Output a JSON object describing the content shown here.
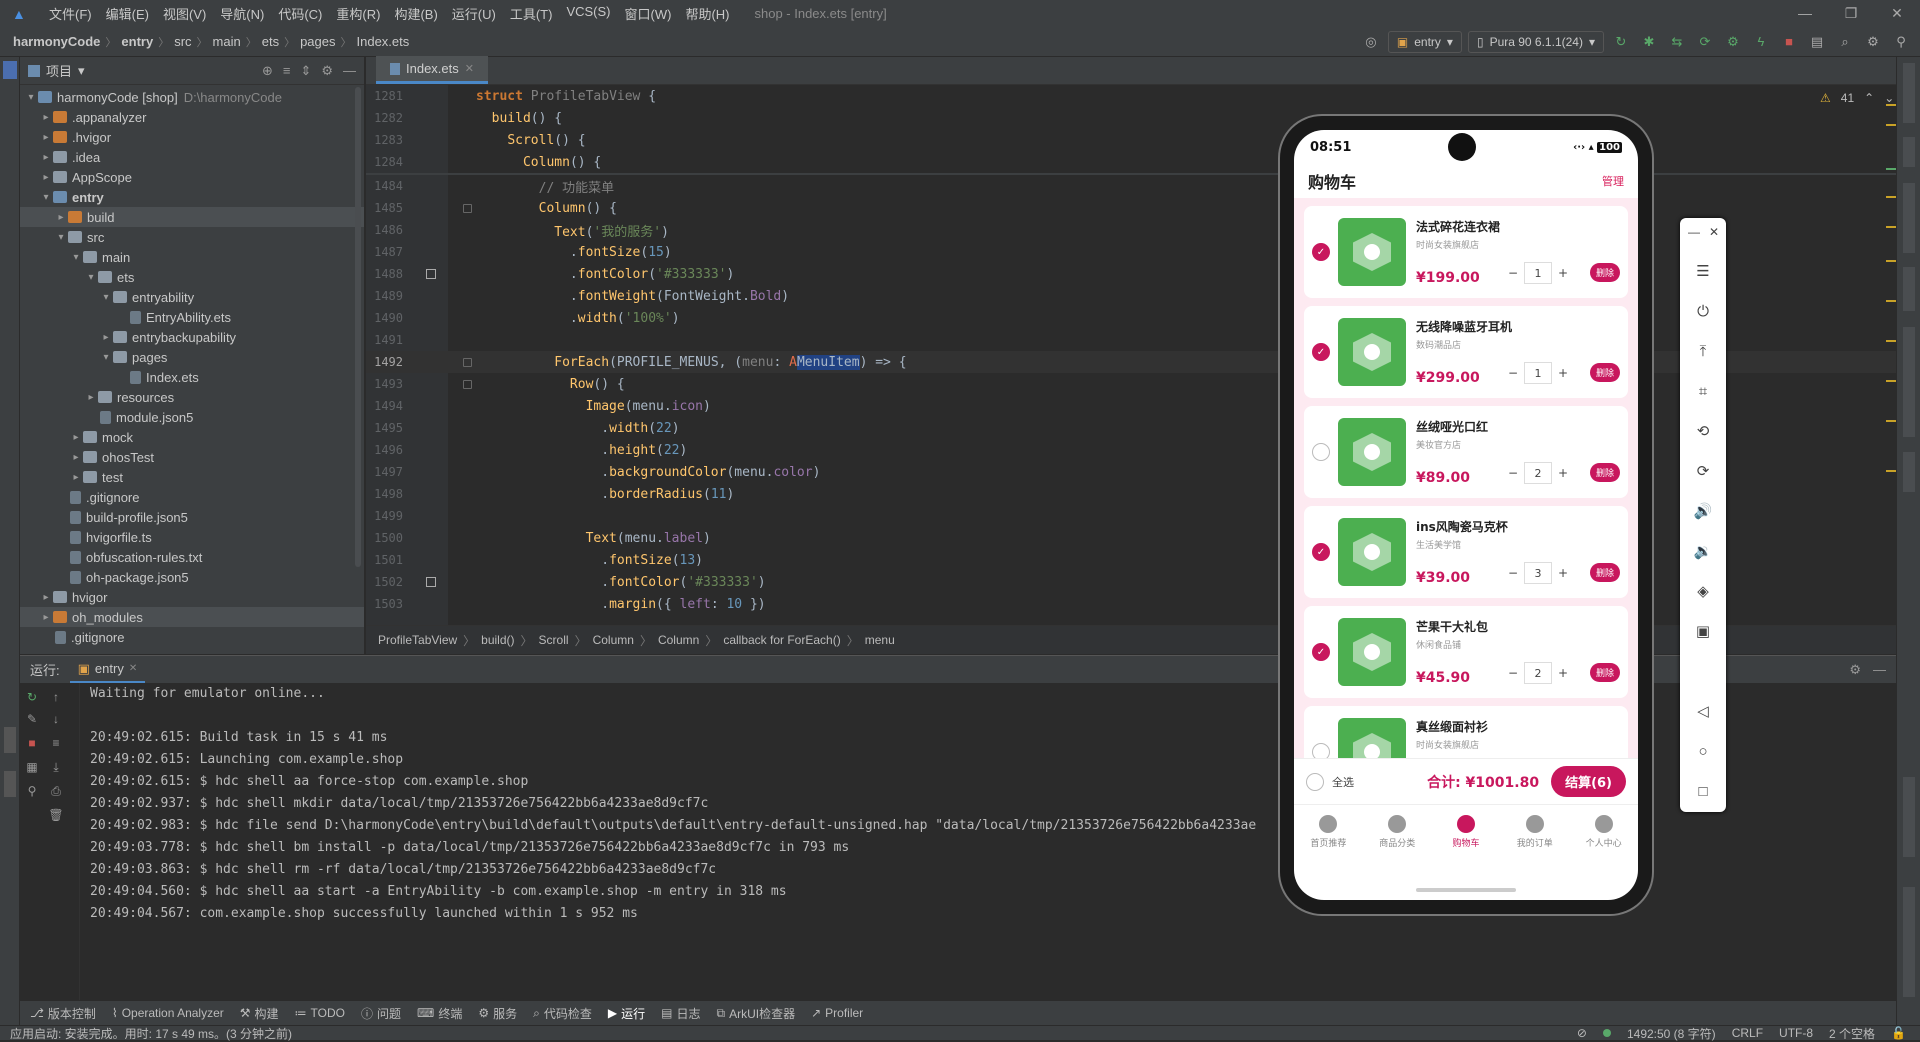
{
  "menubar": {
    "items": [
      "文件(F)",
      "编辑(E)",
      "视图(V)",
      "导航(N)",
      "代码(C)",
      "重构(R)",
      "构建(B)",
      "运行(U)",
      "工具(T)",
      "VCS(S)",
      "窗口(W)",
      "帮助(H)"
    ],
    "window_title": "shop - Index.ets [entry]"
  },
  "navbar": {
    "breadcrumbs": [
      "harmonyCode",
      "entry",
      "src",
      "main",
      "ets",
      "pages",
      "Index.ets"
    ],
    "run_config": "entry",
    "device": "Pura 90 6.1.1(24)"
  },
  "project": {
    "title": "项目",
    "tree": [
      {
        "label": "harmonyCode [shop]",
        "path": "D:\\harmonyCode",
        "depth": 0,
        "arrow": "▾",
        "icon": "module"
      },
      {
        "label": ".appanalyzer",
        "depth": 1,
        "arrow": "▸",
        "icon": "orange"
      },
      {
        "label": ".hvigor",
        "depth": 1,
        "arrow": "▸",
        "icon": "orange"
      },
      {
        "label": ".idea",
        "depth": 1,
        "arrow": "▸",
        "icon": "folder"
      },
      {
        "label": "AppScope",
        "depth": 1,
        "arrow": "▸",
        "icon": "folder"
      },
      {
        "label": "entry",
        "depth": 1,
        "arrow": "▾",
        "icon": "module",
        "bold": true
      },
      {
        "label": "build",
        "depth": 2,
        "arrow": "▸",
        "icon": "orange",
        "sel": true
      },
      {
        "label": "src",
        "depth": 2,
        "arrow": "▾",
        "icon": "folder"
      },
      {
        "label": "main",
        "depth": 3,
        "arrow": "▾",
        "icon": "folder"
      },
      {
        "label": "ets",
        "depth": 4,
        "arrow": "▾",
        "icon": "folder"
      },
      {
        "label": "entryability",
        "depth": 5,
        "arrow": "▾",
        "icon": "folder"
      },
      {
        "label": "EntryAbility.ets",
        "depth": 6,
        "arrow": "",
        "icon": "file"
      },
      {
        "label": "entrybackupability",
        "depth": 5,
        "arrow": "▸",
        "icon": "folder"
      },
      {
        "label": "pages",
        "depth": 5,
        "arrow": "▾",
        "icon": "folder"
      },
      {
        "label": "Index.ets",
        "depth": 6,
        "arrow": "",
        "icon": "file"
      },
      {
        "label": "resources",
        "depth": 4,
        "arrow": "▸",
        "icon": "folder"
      },
      {
        "label": "module.json5",
        "depth": 4,
        "arrow": "",
        "icon": "file"
      },
      {
        "label": "mock",
        "depth": 3,
        "arrow": "▸",
        "icon": "folder"
      },
      {
        "label": "ohosTest",
        "depth": 3,
        "arrow": "▸",
        "icon": "folder"
      },
      {
        "label": "test",
        "depth": 3,
        "arrow": "▸",
        "icon": "folder"
      },
      {
        "label": ".gitignore",
        "depth": 2,
        "arrow": "",
        "icon": "file"
      },
      {
        "label": "build-profile.json5",
        "depth": 2,
        "arrow": "",
        "icon": "file"
      },
      {
        "label": "hvigorfile.ts",
        "depth": 2,
        "arrow": "",
        "icon": "file"
      },
      {
        "label": "obfuscation-rules.txt",
        "depth": 2,
        "arrow": "",
        "icon": "file"
      },
      {
        "label": "oh-package.json5",
        "depth": 2,
        "arrow": "",
        "icon": "file"
      },
      {
        "label": "hvigor",
        "depth": 1,
        "arrow": "▸",
        "icon": "folder"
      },
      {
        "label": "oh_modules",
        "depth": 1,
        "arrow": "▸",
        "icon": "orange",
        "sel": true
      },
      {
        "label": ".gitignore",
        "depth": 1,
        "arrow": "",
        "icon": "file"
      }
    ]
  },
  "editor": {
    "tab": "Index.ets",
    "warnings": "41",
    "breadcrumb": [
      "ProfileTabView",
      "build()",
      "Scroll",
      "Column",
      "Column",
      "callback for ForEach()",
      "menu"
    ]
  },
  "run": {
    "label": "运行:",
    "tab": "entry",
    "lines": [
      "Waiting for emulator online...",
      "",
      "20:49:02.615: Build task in 15 s 41 ms",
      "20:49:02.615: Launching com.example.shop",
      "20:49:02.615: $ hdc shell aa force-stop com.example.shop",
      "20:49:02.937: $ hdc shell mkdir data/local/tmp/21353726e756422bb6a4233ae8d9cf7c",
      "20:49:02.983: $ hdc file send D:\\harmonyCode\\entry\\build\\default\\outputs\\default\\entry-default-unsigned.hap \"data/local/tmp/21353726e756422bb6a4233ae",
      "20:49:03.778: $ hdc shell bm install -p data/local/tmp/21353726e756422bb6a4233ae8d9cf7c in 793 ms",
      "20:49:03.863: $ hdc shell rm -rf data/local/tmp/21353726e756422bb6a4233ae8d9cf7c",
      "20:49:04.560: $ hdc shell aa start -a EntryAbility -b com.example.shop -m entry in 318 ms",
      "20:49:04.567: com.example.shop successfully launched within 1 s 952 ms"
    ]
  },
  "bottomtabs": [
    "版本控制",
    "Operation Analyzer",
    "构建",
    "TODO",
    "问题",
    "终端",
    "服务",
    "代码检查",
    "运行",
    "日志",
    "ArkUI检查器",
    "Profiler"
  ],
  "statusbar": {
    "left": "应用启动: 安装完成。用时: 17 s 49 ms。(3 分钟之前)",
    "pos": "1492:50 (8 字符)",
    "crlf": "CRLF",
    "enc": "UTF-8",
    "indent": "2 个空格"
  },
  "phone": {
    "time": "08:51",
    "status_right": "100",
    "title": "购物车",
    "manage": "管理",
    "items": [
      {
        "name": "法式碎花连衣裙",
        "shop": "时尚女装旗舰店",
        "price": "¥199.00",
        "qty": "1",
        "checked": true
      },
      {
        "name": "无线降噪蓝牙耳机",
        "shop": "数码潮品店",
        "price": "¥299.00",
        "qty": "1",
        "checked": true
      },
      {
        "name": "丝绒哑光口红",
        "shop": "美妆官方店",
        "price": "¥89.00",
        "qty": "2",
        "checked": false
      },
      {
        "name": "ins风陶瓷马克杯",
        "shop": "生活美学馆",
        "price": "¥39.00",
        "qty": "3",
        "checked": true
      },
      {
        "name": "芒果干大礼包",
        "shop": "休闲食品铺",
        "price": "¥45.90",
        "qty": "2",
        "checked": true
      },
      {
        "name": "真丝缎面衬衫",
        "shop": "时尚女装旗舰店",
        "price": "",
        "qty": "",
        "checked": false
      }
    ],
    "delete_label": "删除",
    "select_all": "全选",
    "total": "合计: ¥1001.80",
    "checkout": "结算(6)",
    "tabs": [
      "首页推荐",
      "商品分类",
      "购物车",
      "我的订单",
      "个人中心"
    ],
    "active_tab": 2
  },
  "colors": {
    "accent": "#c8175d",
    "product_green": "#4caf50",
    "ide_bg": "#2b2b2b"
  }
}
